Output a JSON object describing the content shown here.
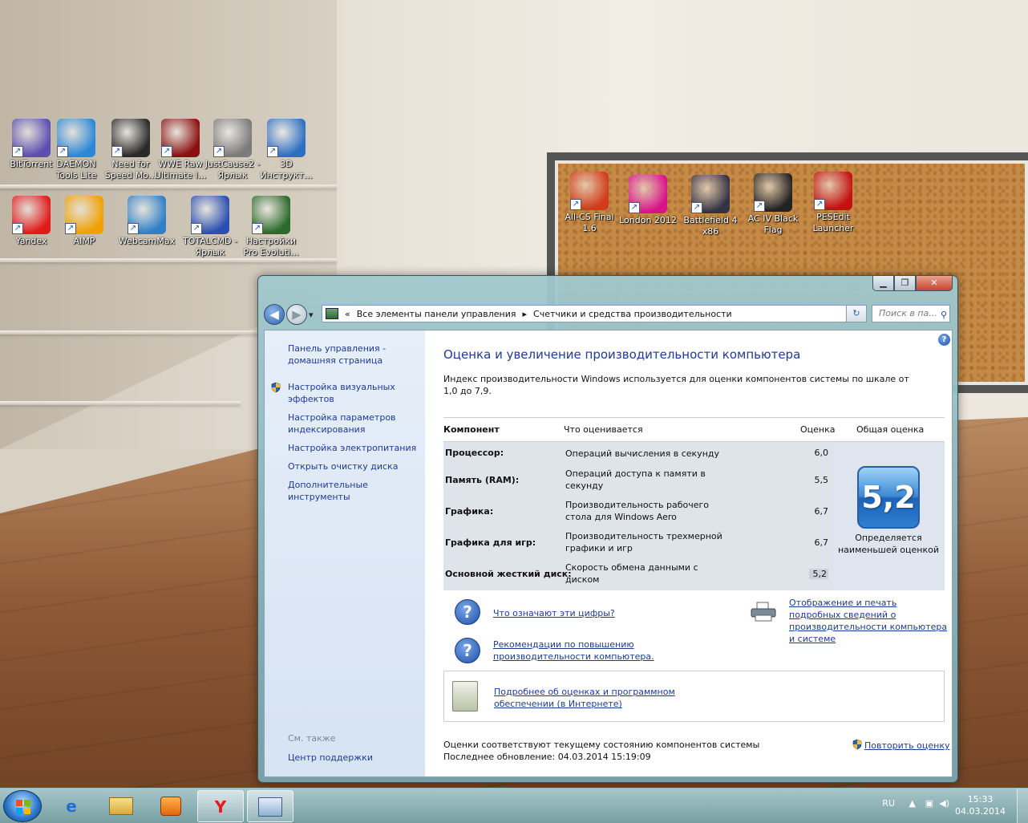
{
  "desktop": {
    "icons": [
      {
        "label": "BitTorrent",
        "icon": "bittorrent-icon",
        "color": "#5b4fb0"
      },
      {
        "label": "DAEMON Tools Lite",
        "icon": "daemon-tools-icon",
        "color": "#2b88d8"
      },
      {
        "label": "Need for Speed Mo...",
        "icon": "nfs-icon",
        "color": "#2a2a2a"
      },
      {
        "label": "WWE Raw Ultimate I...",
        "icon": "wwe-icon",
        "color": "#8a1010"
      },
      {
        "label": "JustCause2 - Ярлык",
        "icon": "justcause-icon",
        "color": "#7b7b7b"
      },
      {
        "label": "3D Инструкт...",
        "icon": "3d-instruct-icon",
        "color": "#2d6fc2"
      },
      {
        "label": "Yandex",
        "icon": "yandex-icon",
        "color": "#e11a1a"
      },
      {
        "label": "AIMP",
        "icon": "aimp-icon",
        "color": "#f0a000"
      },
      {
        "label": "WebcamMax",
        "icon": "webcammax-icon",
        "color": "#2f80c7"
      },
      {
        "label": "TOTALCMD - Ярлык",
        "icon": "totalcmd-icon",
        "color": "#2a4fb0"
      },
      {
        "label": "Настройки Pro Evoluti...",
        "icon": "pes-icon",
        "color": "#2b6a2b"
      },
      {
        "label": "All-CS Final 1.6",
        "icon": "cs-icon",
        "color": "#d23a1a"
      },
      {
        "label": "London 2012",
        "icon": "london-icon",
        "color": "#d8138a"
      },
      {
        "label": "Battlefield 4 x86",
        "icon": "battlefield-icon",
        "color": "#334"
      },
      {
        "label": "AC IV Black Flag",
        "icon": "ac4-icon",
        "color": "#222"
      },
      {
        "label": "PESEdit Launcher",
        "icon": "pesedit-icon",
        "color": "#c31010"
      }
    ]
  },
  "window": {
    "buttons": {
      "min": "▁",
      "max": "❐",
      "close": "✕"
    },
    "nav": {
      "back": "◀",
      "forward": "▶",
      "recent": "▾"
    },
    "address": {
      "root_arrow": "«",
      "crumb1": "Все элементы панели управления",
      "sep": "▸",
      "crumb2": "Счетчики и средства производительности",
      "drop": "▾"
    },
    "refresh": "↻",
    "search_placeholder": "Поиск в па...",
    "help": "?"
  },
  "sidebar": {
    "home": "Панель управления - домашняя страница",
    "items": [
      "Настройка визуальных эффектов",
      "Настройка параметров индексирования",
      "Настройка электропитания",
      "Открыть очистку диска",
      "Дополнительные инструменты"
    ],
    "see_also": "См. также",
    "support": "Центр поддержки"
  },
  "main": {
    "title": "Оценка и увеличение производительности компьютера",
    "description": "Индекс производительности Windows используется для оценки компонентов системы по шкале от 1,0 до 7,9.",
    "table": {
      "headers": {
        "component": "Компонент",
        "what": "Что оценивается",
        "score": "Оценка",
        "overall": "Общая оценка"
      },
      "rows": [
        {
          "component": "Процессор:",
          "what": "Операций вычисления в секунду",
          "score": "6,0"
        },
        {
          "component": "Память (RAM):",
          "what": "Операций доступа к памяти в секунду",
          "score": "5,5"
        },
        {
          "component": "Графика:",
          "what": "Производительность рабочего стола для Windows Aero",
          "score": "6,7"
        },
        {
          "component": "Графика для игр:",
          "what": "Производительность трехмерной графики и игр",
          "score": "6,7"
        },
        {
          "component": "Основной жесткий диск:",
          "what": "Скорость обмена данными с диском",
          "score": "5,2"
        }
      ],
      "overall_score": "5,2",
      "overall_note": "Определяется наименьшей оценкой"
    },
    "links": {
      "what_numbers": "Что означают эти цифры?",
      "tips": "Рекомендации по повышению производительности компьютера.",
      "print": "Отображение и печать подробных сведений о производительности компьютера и системе",
      "more": "Подробнее об оценках и программном обеспечении (в Интернете)",
      "rerun": "Повторить оценку"
    },
    "footer": {
      "state": "Оценки соответствуют текущему состоянию компонентов системы",
      "updated": "Последнее обновление: 04.03.2014 15:19:09"
    }
  },
  "taskbar": {
    "lang": "RU",
    "time": "15:33",
    "date": "04.03.2014"
  }
}
